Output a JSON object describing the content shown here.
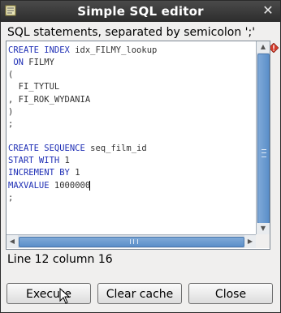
{
  "window": {
    "title": "Simple SQL editor",
    "close_glyph": "✕"
  },
  "caption": "SQL statements, separated by semicolon ';'",
  "editor": {
    "lines": [
      [
        {
          "t": "CREATE INDEX ",
          "k": true
        },
        {
          "t": "idx_FILMY_lookup",
          "k": false
        }
      ],
      [
        {
          "t": " ON ",
          "k": true
        },
        {
          "t": "FILMY",
          "k": false
        }
      ],
      [
        {
          "t": "(",
          "k": false
        }
      ],
      [
        {
          "t": "  FI_TYTUL",
          "k": false
        }
      ],
      [
        {
          "t": ", FI_ROK_WYDANIA",
          "k": false
        }
      ],
      [
        {
          "t": ")",
          "k": false
        }
      ],
      [
        {
          "t": ";",
          "k": false
        }
      ],
      [
        {
          "t": "",
          "k": false
        }
      ],
      [
        {
          "t": "CREATE SEQUENCE ",
          "k": true
        },
        {
          "t": "seq_film_id",
          "k": false
        }
      ],
      [
        {
          "t": "START WITH ",
          "k": true
        },
        {
          "t": "1",
          "k": false
        }
      ],
      [
        {
          "t": "INCREMENT BY ",
          "k": true
        },
        {
          "t": "1",
          "k": false
        }
      ],
      [
        {
          "t": "MAXVALUE ",
          "k": true
        },
        {
          "t": "1000000",
          "k": false
        }
      ],
      [
        {
          "t": ";",
          "k": false
        }
      ]
    ],
    "caret_line": 12,
    "caret_column": 16
  },
  "status": "Line 12 column 16",
  "buttons": {
    "execute": "Execute",
    "clear_cache": "Clear cache",
    "close": "Close"
  },
  "icons": {
    "app": "editor-app-icon",
    "warning": "warning-diamond-icon",
    "cursor": "mouse-pointer-icon"
  },
  "colors": {
    "keyword": "#1f2fb5",
    "scroll_thumb": "#6b9bd0",
    "titlebar": "#3a3a3a"
  }
}
